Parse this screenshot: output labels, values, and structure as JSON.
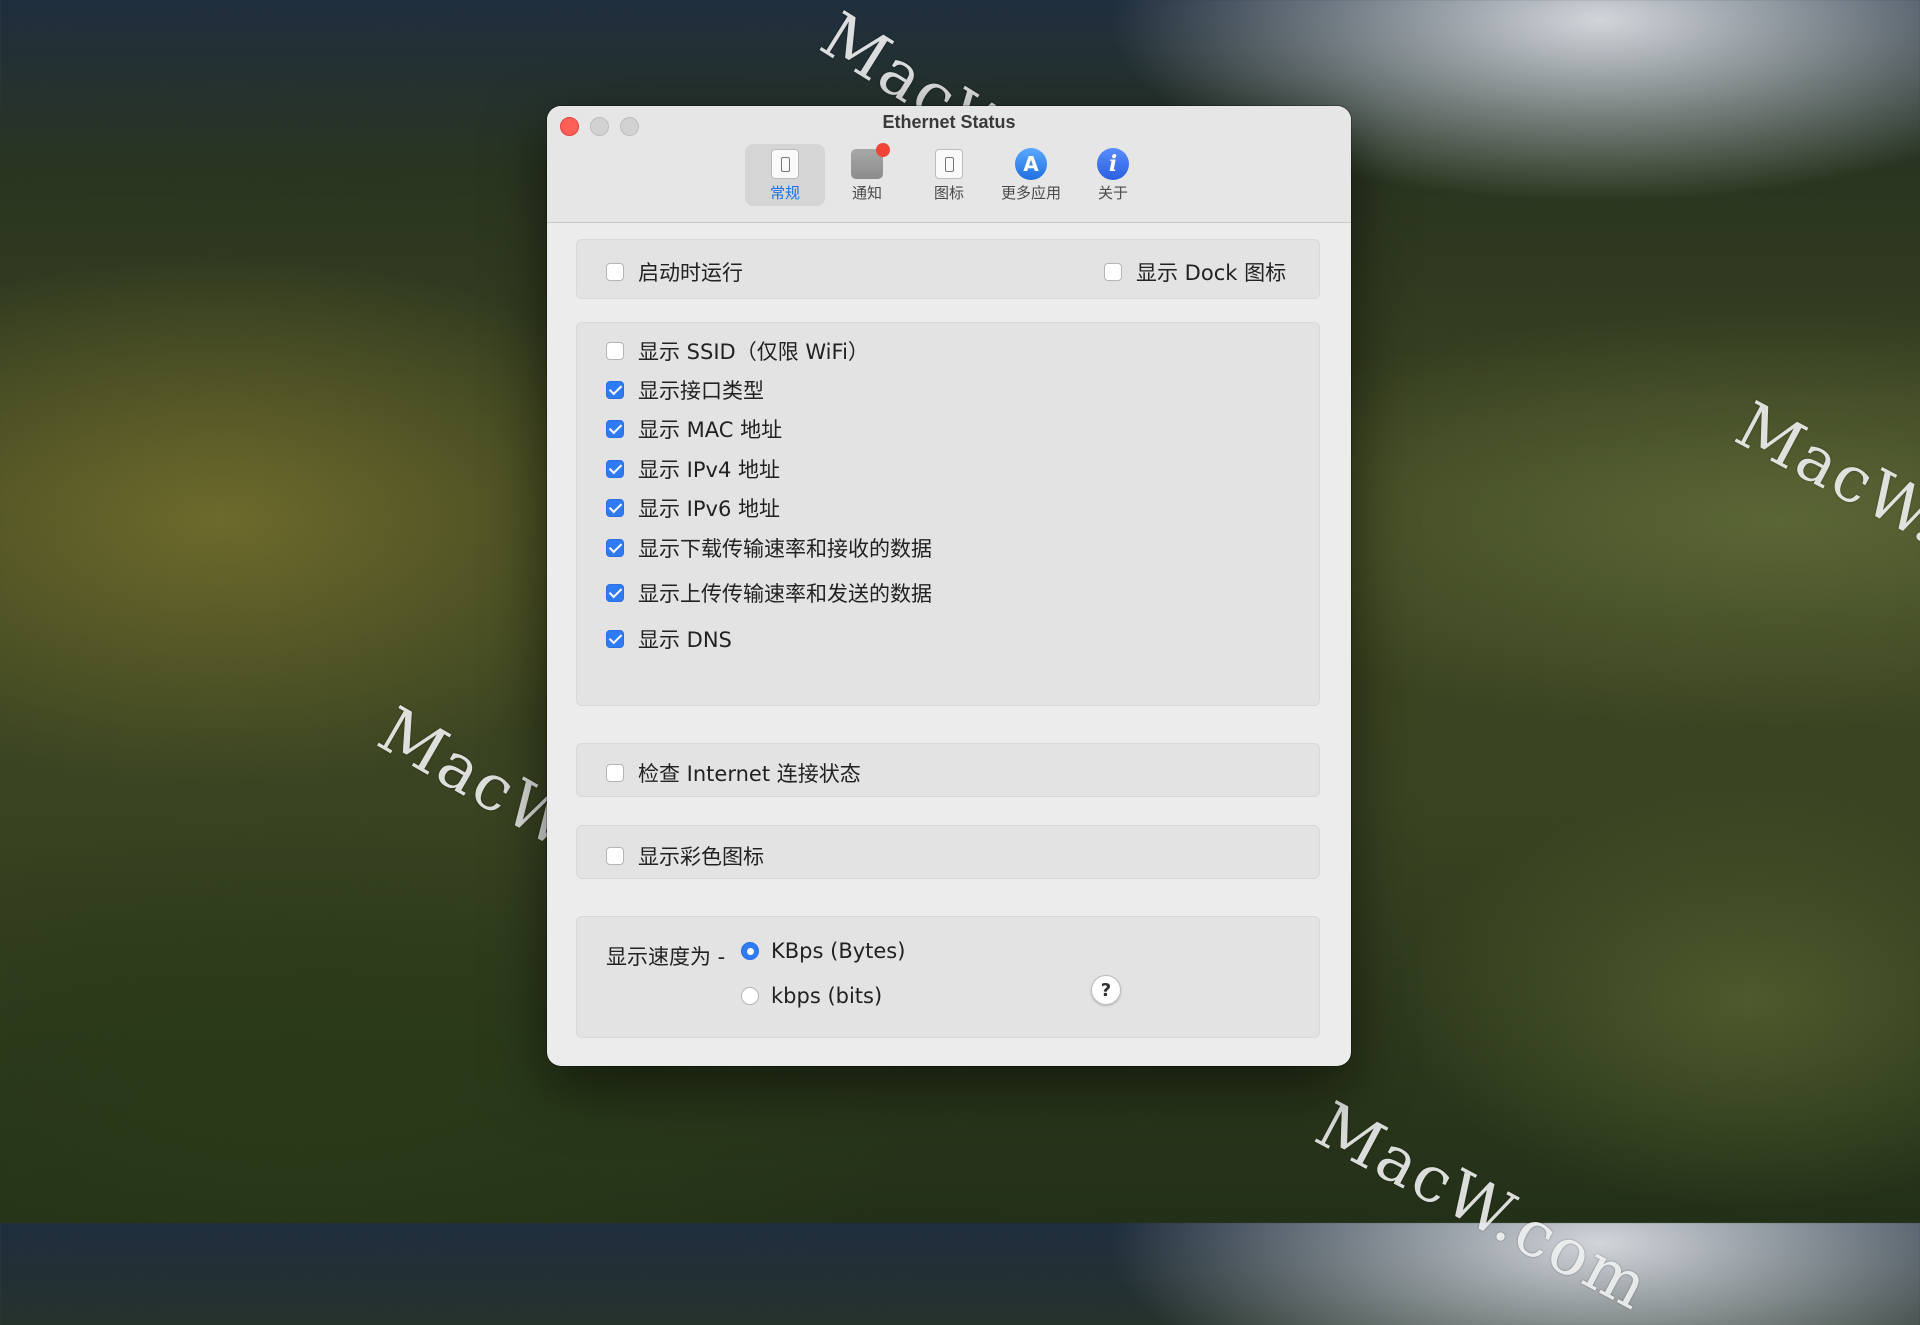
{
  "window": {
    "title": "Ethernet Status"
  },
  "toolbar": {
    "items": [
      {
        "label": "常规",
        "icon": "switch-icon",
        "active": true
      },
      {
        "label": "通知",
        "icon": "notification-icon",
        "active": false
      },
      {
        "label": "图标",
        "icon": "switch-icon",
        "active": false
      },
      {
        "label": "更多应用",
        "icon": "app-store-icon",
        "active": false
      },
      {
        "label": "关于",
        "icon": "info-icon",
        "active": false
      }
    ]
  },
  "general": {
    "launch_at_login": {
      "label": "启动时运行",
      "checked": false
    },
    "show_dock_icon": {
      "label": "显示 Dock 图标",
      "checked": false
    }
  },
  "display_options": [
    {
      "label": "显示 SSID（仅限 WiFi）",
      "checked": false
    },
    {
      "label": "显示接口类型",
      "checked": true
    },
    {
      "label": "显示 MAC 地址",
      "checked": true
    },
    {
      "label": "显示 IPv4 地址",
      "checked": true
    },
    {
      "label": "显示 IPv6 地址",
      "checked": true
    },
    {
      "label": "显示下载传输速率和接收的数据",
      "checked": true
    },
    {
      "label": "显示上传传输速率和发送的数据",
      "checked": true
    },
    {
      "label": "显示 DNS",
      "checked": true
    }
  ],
  "check_internet": {
    "label": "检查 Internet 连接状态",
    "checked": false
  },
  "color_icon": {
    "label": "显示彩色图标",
    "checked": false
  },
  "speed": {
    "label": "显示速度为 -",
    "options": [
      {
        "label": "KBps (Bytes)",
        "selected": true
      },
      {
        "label": "kbps (bits)",
        "selected": false
      }
    ],
    "help": "?"
  },
  "watermark": "MacW.com",
  "colors": {
    "accent": "#2f7bf5",
    "close": "#fe5f57",
    "badge": "#f04438"
  }
}
